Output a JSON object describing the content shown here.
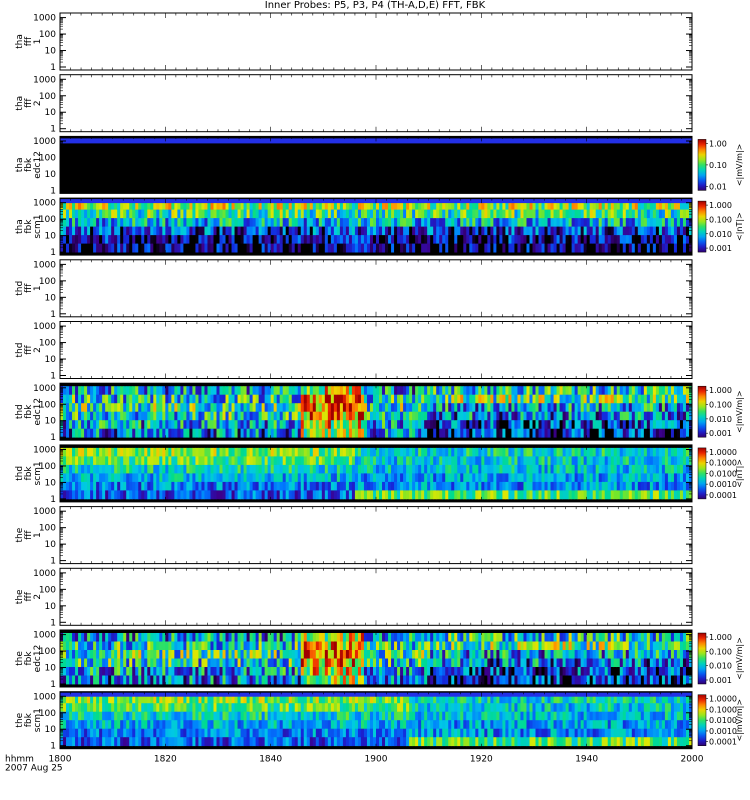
{
  "title": "Inner Probes: P5, P3, P4 (TH-A,D,E) FFT, FBK",
  "footer": {
    "label1": "hhmm",
    "label2": "2007 Aug 25"
  },
  "chart_data": {
    "type": "heatmap",
    "x_ticks": [
      "1800",
      "1820",
      "1840",
      "1900",
      "1920",
      "1940",
      "2000"
    ],
    "y_ticks": [
      "1000",
      "100",
      "10",
      "1"
    ],
    "panels": [
      {
        "id": "tha_fff_1",
        "label": [
          "tha",
          "fff",
          "1"
        ],
        "kind": "empty"
      },
      {
        "id": "tha_fff_2",
        "label": [
          "tha",
          "fff",
          "2"
        ],
        "kind": "empty"
      },
      {
        "id": "tha_fbk_edc12",
        "label": [
          "tha",
          "fbk",
          "edc12"
        ],
        "kind": "black",
        "unit": "<|mV/m|>",
        "cbar_ticks": [
          "1.00",
          "0.10",
          "0.01"
        ]
      },
      {
        "id": "tha_fbk_scm1",
        "label": [
          "tha",
          "fbk",
          "scm1"
        ],
        "kind": "scm_a",
        "unit": "<|nT|>",
        "cbar_ticks": [
          "1.000",
          "0.100",
          "0.010",
          "0.001"
        ]
      },
      {
        "id": "thd_fff_1",
        "label": [
          "thd",
          "fff",
          "1"
        ],
        "kind": "empty"
      },
      {
        "id": "thd_fff_2",
        "label": [
          "thd",
          "fff",
          "2"
        ],
        "kind": "empty"
      },
      {
        "id": "thd_fbk_edc12",
        "label": [
          "thd",
          "fbk",
          "edc12"
        ],
        "kind": "edc",
        "unit": "<|mV/m|>",
        "cbar_ticks": [
          "1.000",
          "0.100",
          "0.010",
          "0.001"
        ]
      },
      {
        "id": "thd_fbk_scm1",
        "label": [
          "thd",
          "fbk",
          "scm1"
        ],
        "kind": "scm_d",
        "unit": "<|nT|>",
        "cbar_ticks": [
          "1.0000",
          "0.1000",
          "0.0100",
          "0.0010",
          "0.0001"
        ]
      },
      {
        "id": "the_fff_1",
        "label": [
          "the",
          "fff",
          "1"
        ],
        "kind": "empty"
      },
      {
        "id": "the_fff_2",
        "label": [
          "the",
          "fff",
          "2"
        ],
        "kind": "empty"
      },
      {
        "id": "the_fbk_edc12",
        "label": [
          "the",
          "fbk",
          "edc12"
        ],
        "kind": "edc",
        "unit": "<|mV/m|>",
        "cbar_ticks": [
          "1.000",
          "0.100",
          "0.010",
          "0.001"
        ]
      },
      {
        "id": "the_fbk_scm1",
        "label": [
          "the",
          "fbk",
          "scm1"
        ],
        "kind": "scm_e",
        "unit": "<|mV/m|>",
        "cbar_ticks": [
          "1.0000",
          "0.1000",
          "0.0100",
          "0.0010",
          "0.0001"
        ]
      }
    ]
  }
}
